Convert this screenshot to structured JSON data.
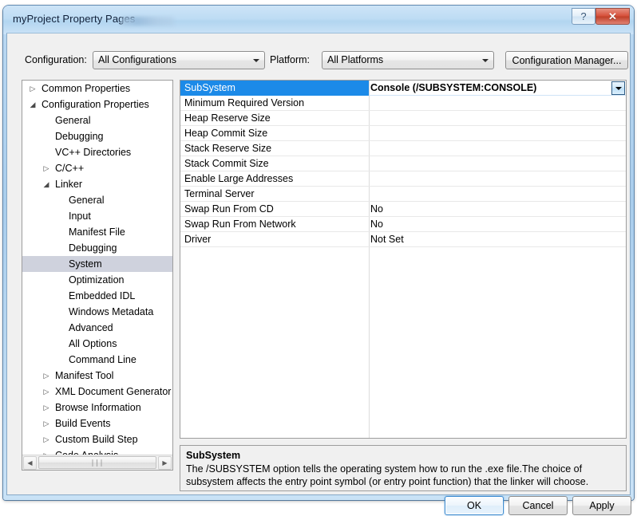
{
  "window": {
    "title": "myProject Property Pages",
    "help_button": "?",
    "close_button": "✕"
  },
  "config_bar": {
    "configuration_label": "Configuration:",
    "configuration_value": "All Configurations",
    "platform_label": "Platform:",
    "platform_value": "All Platforms",
    "configuration_manager_label": "Configuration Manager..."
  },
  "tree": {
    "items": [
      {
        "label": "Common Properties",
        "depth": 0,
        "glyph": "▷",
        "selected": false
      },
      {
        "label": "Configuration Properties",
        "depth": 0,
        "glyph": "◢",
        "selected": false
      },
      {
        "label": "General",
        "depth": 1,
        "glyph": "",
        "selected": false
      },
      {
        "label": "Debugging",
        "depth": 1,
        "glyph": "",
        "selected": false
      },
      {
        "label": "VC++ Directories",
        "depth": 1,
        "glyph": "",
        "selected": false
      },
      {
        "label": "C/C++",
        "depth": 1,
        "glyph": "▷",
        "selected": false
      },
      {
        "label": "Linker",
        "depth": 1,
        "glyph": "◢",
        "selected": false
      },
      {
        "label": "General",
        "depth": 2,
        "glyph": "",
        "selected": false
      },
      {
        "label": "Input",
        "depth": 2,
        "glyph": "",
        "selected": false
      },
      {
        "label": "Manifest File",
        "depth": 2,
        "glyph": "",
        "selected": false
      },
      {
        "label": "Debugging",
        "depth": 2,
        "glyph": "",
        "selected": false
      },
      {
        "label": "System",
        "depth": 2,
        "glyph": "",
        "selected": true
      },
      {
        "label": "Optimization",
        "depth": 2,
        "glyph": "",
        "selected": false
      },
      {
        "label": "Embedded IDL",
        "depth": 2,
        "glyph": "",
        "selected": false
      },
      {
        "label": "Windows Metadata",
        "depth": 2,
        "glyph": "",
        "selected": false
      },
      {
        "label": "Advanced",
        "depth": 2,
        "glyph": "",
        "selected": false
      },
      {
        "label": "All Options",
        "depth": 2,
        "glyph": "",
        "selected": false
      },
      {
        "label": "Command Line",
        "depth": 2,
        "glyph": "",
        "selected": false
      },
      {
        "label": "Manifest Tool",
        "depth": 1,
        "glyph": "▷",
        "selected": false
      },
      {
        "label": "XML Document Generator",
        "depth": 1,
        "glyph": "▷",
        "selected": false
      },
      {
        "label": "Browse Information",
        "depth": 1,
        "glyph": "▷",
        "selected": false
      },
      {
        "label": "Build Events",
        "depth": 1,
        "glyph": "▷",
        "selected": false
      },
      {
        "label": "Custom Build Step",
        "depth": 1,
        "glyph": "▷",
        "selected": false
      },
      {
        "label": "Code Analysis",
        "depth": 1,
        "glyph": "▷",
        "selected": false
      }
    ],
    "hscroll": {
      "left_arrow": "◀",
      "right_arrow": "▶",
      "thumb_grip": "∣∣∣"
    }
  },
  "property_grid": {
    "rows": [
      {
        "name": "SubSystem",
        "value": "Console (/SUBSYSTEM:CONSOLE)",
        "selected": true
      },
      {
        "name": "Minimum Required Version",
        "value": "",
        "selected": false
      },
      {
        "name": "Heap Reserve Size",
        "value": "",
        "selected": false
      },
      {
        "name": "Heap Commit Size",
        "value": "",
        "selected": false
      },
      {
        "name": "Stack Reserve Size",
        "value": "",
        "selected": false
      },
      {
        "name": "Stack Commit Size",
        "value": "",
        "selected": false
      },
      {
        "name": "Enable Large Addresses",
        "value": "",
        "selected": false
      },
      {
        "name": "Terminal Server",
        "value": "",
        "selected": false
      },
      {
        "name": "Swap Run From CD",
        "value": "No",
        "selected": false
      },
      {
        "name": "Swap Run From Network",
        "value": "No",
        "selected": false
      },
      {
        "name": "Driver",
        "value": "Not Set",
        "selected": false
      }
    ]
  },
  "description": {
    "title": "SubSystem",
    "body": "The /SUBSYSTEM option tells the operating system how to run the .exe file.The choice of subsystem affects the entry point symbol (or entry point function) that the linker will choose."
  },
  "footer": {
    "ok_label": "OK",
    "cancel_label": "Cancel",
    "apply_label": "Apply"
  },
  "colors": {
    "selection_blue": "#1c8ae8",
    "tree_selection": "#cfd2dd",
    "titlebar_blue": "#bedcf4",
    "close_red": "#d6503a",
    "dialog_face": "#f0f0f0"
  }
}
